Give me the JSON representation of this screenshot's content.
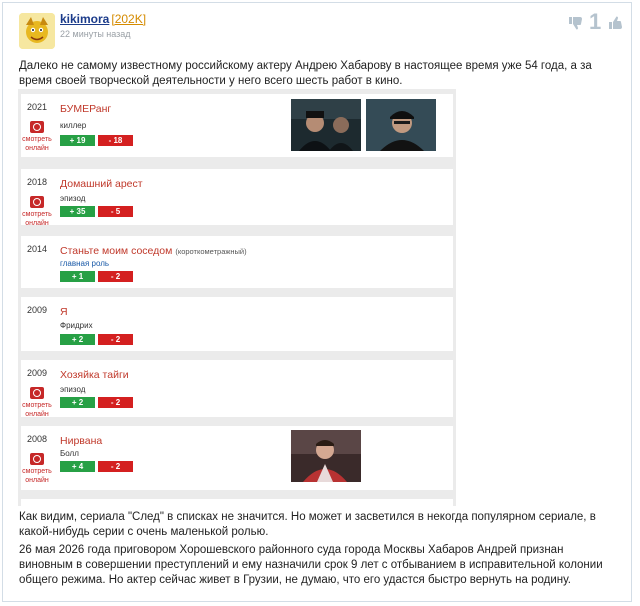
{
  "comment": {
    "username": "kikimora",
    "rating": "[202K]",
    "time": "22 минуты назад",
    "vote_count": "1",
    "colors": {
      "username": "#1b3b8a",
      "rating": "#d58b00",
      "accent_red": "#c62828",
      "plus": "#27a045",
      "minus": "#d42020"
    }
  },
  "paragraphs": [
    "Далеко не самому известному российскому актеру Андрею Хабарову в настоящее время уже 54 года, а за время своей творческой деятельности у него всего шесть работ в кино.",
    "Как видим, сериала \"След\" в списках не значится. Но может и засветился в некогда популярном сериале, в какой-нибудь серии с очень маленькой ролью.",
    "26 мая 2026 года приговором Хорошевского районного суда города Москвы Хабаров Андрей признан виновным в совершении преступлений и ему назначили срок 9 лет с отбыванием в исправительной колонии общего режима. Но актер сейчас живет в Грузии, не думаю, что его удастся быстро вернуть на родину."
  ],
  "films": [
    {
      "year": "2021",
      "watch": "смотреть онлайн",
      "title": "БУМЕРанг",
      "note": "",
      "role": "киллер",
      "plus": "+ 19",
      "minus": "- 18"
    },
    {
      "year": "2018",
      "watch": "смотреть онлайн",
      "title": "Домашний арест",
      "note": "",
      "role": "эпизод",
      "plus": "+ 35",
      "minus": "- 5"
    },
    {
      "year": "2014",
      "watch": "",
      "title": "Станьте моим соседом",
      "note": "(короткометражный)",
      "role": "главная роль",
      "plus": "+ 1",
      "minus": "- 2"
    },
    {
      "year": "2009",
      "watch": "",
      "title": "Я",
      "note": "",
      "role": "Фридрих",
      "plus": "+ 2",
      "minus": "- 2"
    },
    {
      "year": "2009",
      "watch": "смотреть онлайн",
      "title": "Хозяйка тайги",
      "note": "",
      "role": "эпизод",
      "plus": "+ 2",
      "minus": "- 2"
    },
    {
      "year": "2008",
      "watch": "смотреть онлайн",
      "title": "Нирвана",
      "note": "",
      "role": "Болл",
      "plus": "+ 4",
      "minus": "- 2"
    }
  ]
}
